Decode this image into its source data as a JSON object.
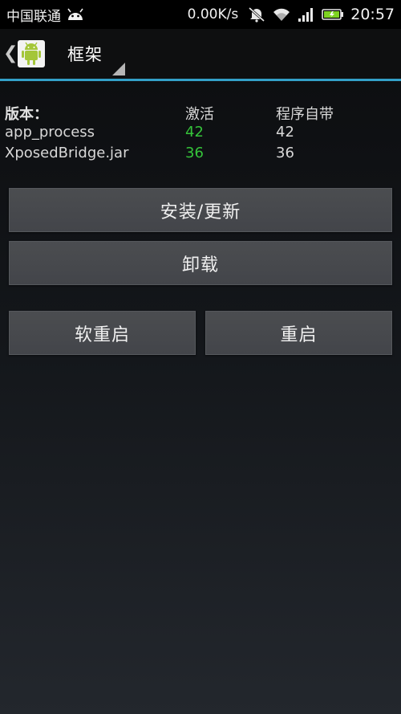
{
  "status_bar": {
    "carrier": "中国联通",
    "net_speed": "0.00K/s",
    "time": "20:57"
  },
  "action_bar": {
    "back_glyph": "❮",
    "title": "框架"
  },
  "versions": {
    "header": {
      "label": "版本：",
      "active": "激活",
      "bundled": "程序自带"
    },
    "rows": [
      {
        "name": "app_process",
        "active": "42",
        "bundled": "42"
      },
      {
        "name": "XposedBridge.jar",
        "active": "36",
        "bundled": "36"
      }
    ]
  },
  "buttons": {
    "install": "安装/更新",
    "uninstall": "卸载",
    "soft_reboot": "软重启",
    "reboot": "重启"
  },
  "colors": {
    "active_value": "#35c43a",
    "divider": "#33a0c8",
    "android_green": "#a4c639"
  },
  "icons": {
    "status": [
      "android-notification-icon",
      "mute-icon",
      "wifi-icon",
      "signal-icon",
      "battery-icon"
    ],
    "app": "android-robot-icon"
  }
}
